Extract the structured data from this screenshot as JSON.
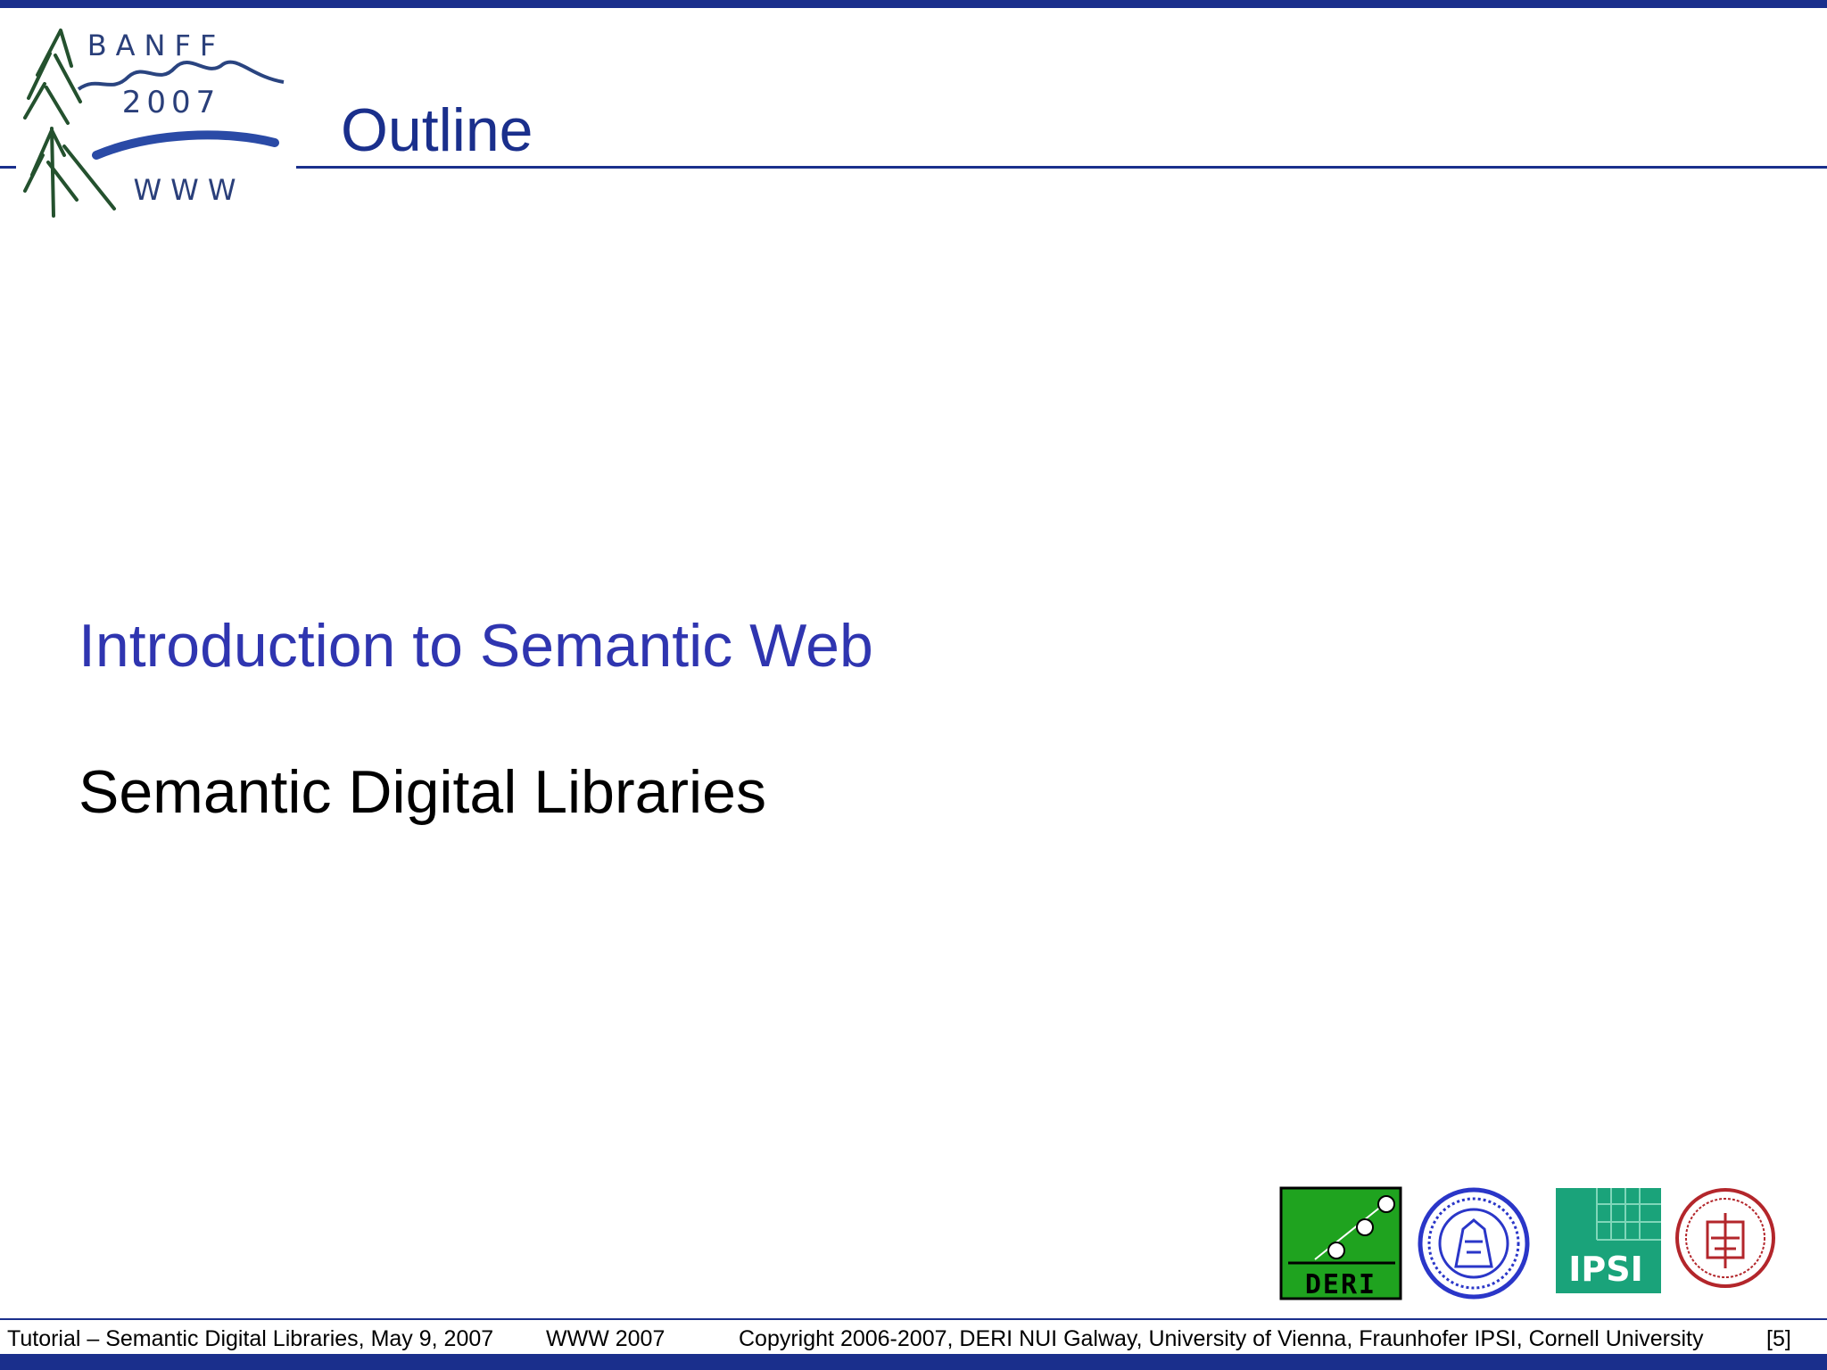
{
  "slide": {
    "title": "Outline",
    "items": [
      "Introduction to Semantic Web",
      "Semantic Digital Libraries"
    ]
  },
  "conference_logo": {
    "name": "BANFF",
    "year": "2007",
    "label": "WWW"
  },
  "footer": {
    "tutorial": "Tutorial – Semantic Digital Libraries, May 9, 2007",
    "conference": "WWW 2007",
    "copyright": "Copyright 2006-2007, DERI NUI Galway, University of Vienna, Fraunhofer IPSI, Cornell University",
    "page": "[5]"
  },
  "partner_logos": {
    "deri": "DERI",
    "ipsi": "IPSI"
  },
  "colors": {
    "brand_blue": "#1a2f8c",
    "item_blue": "#2f35b0",
    "deri_green": "#1fa31f",
    "ipsi_teal": "#1aa37a",
    "vienna_blue": "#2a36c8",
    "cornell_red": "#b3262b"
  }
}
